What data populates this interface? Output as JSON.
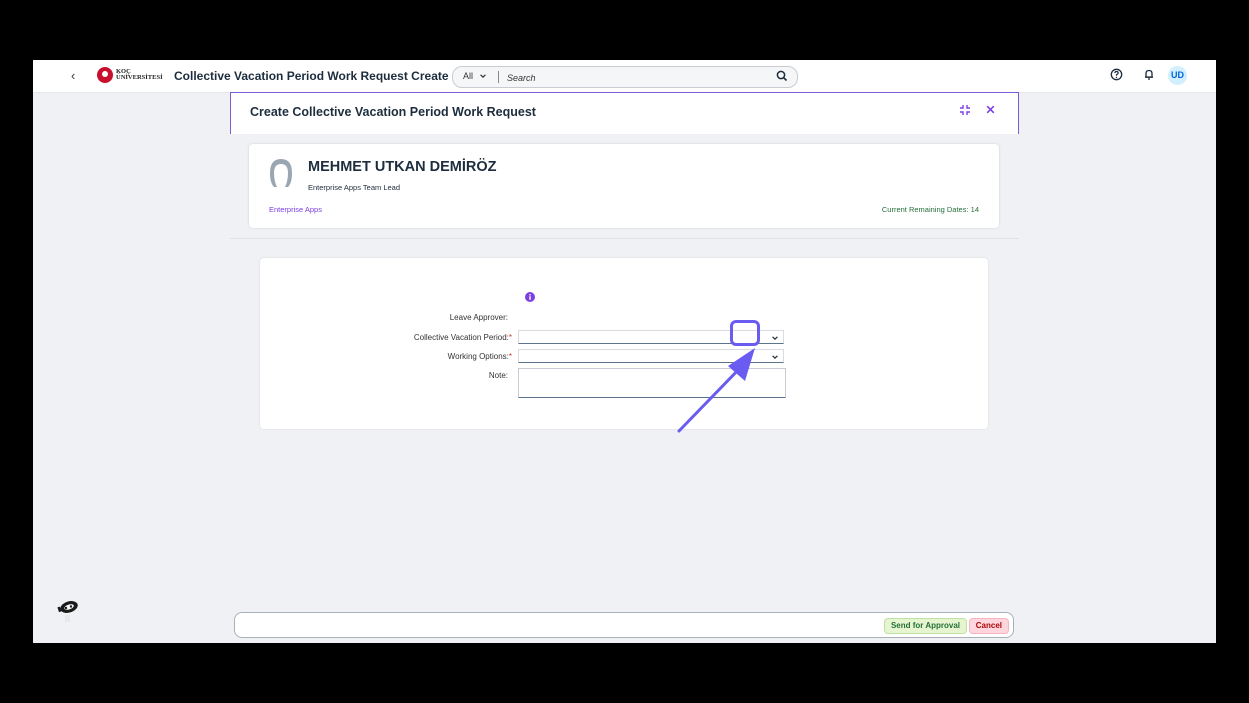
{
  "shell": {
    "back_label": "‹",
    "logo_text_line1": "KOÇ",
    "logo_text_line2": "ÜNİVERSİTESİ",
    "app_title": "Collective Vacation Period Work Request Create",
    "search_scope": "All",
    "search_placeholder": "Search",
    "avatar_initials": "UD",
    "icons": [
      "help-icon",
      "bell-icon"
    ]
  },
  "dialog": {
    "title": "Create Collective Vacation Period Work Request",
    "profile": {
      "name": "MEHMET UTKAN DEMİRÖZ",
      "role": "Enterprise Apps Team Lead",
      "department": "Enterprise Apps",
      "remaining": "Current Remaining Dates: 14"
    },
    "form": {
      "leave_approver_label": "Leave Approver:",
      "leave_approver_value": "",
      "collective_period_label": "Collective Vacation Period:",
      "collective_period_value": "",
      "working_options_label": "Working Options:",
      "working_options_value": "",
      "note_label": "Note:",
      "required_mark": "*"
    },
    "footer": {
      "send_label": "Send for Approval",
      "cancel_label": "Cancel"
    }
  },
  "colors": {
    "accent": "#7b5cd6",
    "highlight": "#6a5cf0",
    "approve_bg": "#e6f5d0",
    "cancel_bg": "#ffd6dd"
  }
}
